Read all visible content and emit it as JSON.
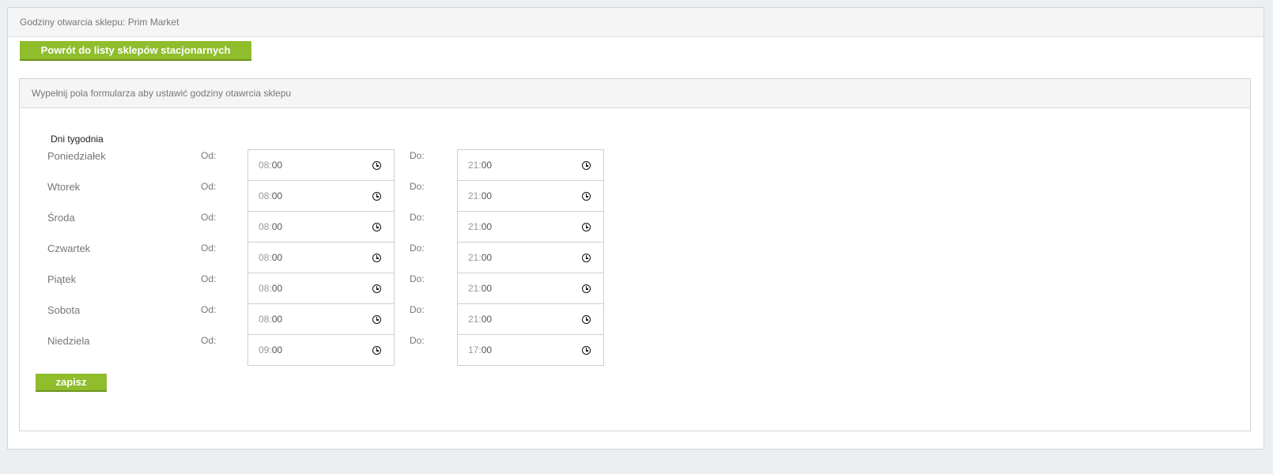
{
  "page": {
    "title": "Godziny otwarcia sklepu: Prim Market",
    "back_button_label": "Powrót do listy sklepów stacjonarnych"
  },
  "form": {
    "instructions": "Wypełnij pola formularza aby ustawić godziny otawrcia sklepu",
    "week_label": "Dni tygodnia",
    "from_label": "Od:",
    "to_label": "Do:",
    "save_label": "zapisz",
    "days": [
      {
        "name": "Poniedziałek",
        "from": {
          "hh": "08",
          "mm": "00"
        },
        "to": {
          "hh": "21",
          "mm": "00"
        }
      },
      {
        "name": "Wtorek",
        "from": {
          "hh": "08",
          "mm": "00"
        },
        "to": {
          "hh": "21",
          "mm": "00"
        }
      },
      {
        "name": "Środa",
        "from": {
          "hh": "08",
          "mm": "00"
        },
        "to": {
          "hh": "21",
          "mm": "00"
        }
      },
      {
        "name": "Czwartek",
        "from": {
          "hh": "08",
          "mm": "00"
        },
        "to": {
          "hh": "21",
          "mm": "00"
        }
      },
      {
        "name": "Piątek",
        "from": {
          "hh": "08",
          "mm": "00"
        },
        "to": {
          "hh": "21",
          "mm": "00"
        }
      },
      {
        "name": "Sobota",
        "from": {
          "hh": "08",
          "mm": "00"
        },
        "to": {
          "hh": "21",
          "mm": "00"
        }
      },
      {
        "name": "Niedziela",
        "from": {
          "hh": "09",
          "mm": "00"
        },
        "to": {
          "hh": "17",
          "mm": "00"
        }
      }
    ]
  },
  "icons": {
    "time_picker": "clock-icon"
  },
  "colors": {
    "accent": "#8fbd2c",
    "page_background": "#eceff2",
    "header_background": "#f5f5f5"
  }
}
